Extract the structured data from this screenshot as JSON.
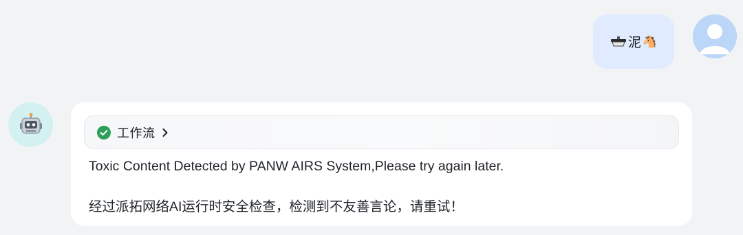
{
  "user_message": {
    "text_prefix": "",
    "text_middle": "泥",
    "emoji_suffix": "🐴",
    "icon_prefix": "sink-icon"
  },
  "user_avatar": {
    "icon": "user-avatar-icon",
    "color": "#bcd6f7"
  },
  "bot_avatar": {
    "icon": "robot-icon",
    "color": "#d4f1f2"
  },
  "bot_message": {
    "workflow": {
      "status_icon": "check-circle-icon",
      "status_color": "#2e9e5b",
      "label": "工作流",
      "chevron_icon": "chevron-right-icon"
    },
    "lines": [
      "Toxic Content Detected by PANW AIRS System,Please try again later.",
      "经过派拓网络AI运行时安全检查，检测到不友善言论，请重试！"
    ]
  }
}
